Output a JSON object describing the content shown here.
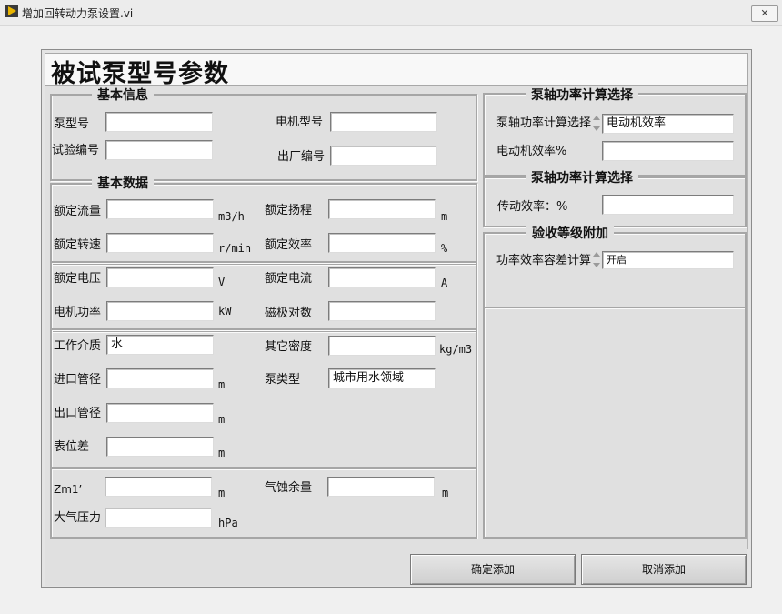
{
  "window": {
    "title": "增加回转动力泵设置.vi"
  },
  "header": {
    "title": "被试泵型号参数"
  },
  "basic_info": {
    "legend": "基本信息",
    "pump_model": {
      "label": "泵型号",
      "value": ""
    },
    "motor_model": {
      "label": "电机型号",
      "value": ""
    },
    "test_number": {
      "label": "试验编号",
      "value": ""
    },
    "factory_number": {
      "label": "出厂编号",
      "value": ""
    }
  },
  "basic_data": {
    "legend": "基本数据",
    "rated_flow": {
      "label": "额定流量",
      "unit": "m3/h",
      "value": ""
    },
    "rated_head": {
      "label": "额定扬程",
      "unit": "m",
      "value": ""
    },
    "rated_speed": {
      "label": "额定转速",
      "unit": "r/min",
      "value": ""
    },
    "rated_efficiency": {
      "label": "额定效率",
      "unit": "%",
      "value": ""
    },
    "rated_voltage": {
      "label": "额定电压",
      "unit": "V",
      "value": ""
    },
    "rated_current": {
      "label": "额定电流",
      "unit": "A",
      "value": ""
    },
    "motor_power": {
      "label": "电机功率",
      "unit": "kW",
      "value": ""
    },
    "pole_pairs": {
      "label": "磁极对数",
      "value": ""
    },
    "medium": {
      "label": "工作介质",
      "value": "水"
    },
    "other_density": {
      "label": "其它密度",
      "unit": "kg/m3",
      "value": ""
    },
    "inlet_pipe": {
      "label": "进口管径",
      "unit": "m",
      "value": ""
    },
    "pump_type": {
      "label": "泵类型",
      "value": "城市用水领域"
    },
    "outlet_pipe": {
      "label": "出口管径",
      "unit": "m",
      "value": ""
    },
    "gauge_diff": {
      "label": "表位差",
      "unit": "m",
      "value": ""
    },
    "zm1": {
      "label": "Zm1’",
      "unit": "m",
      "value": ""
    },
    "npsh": {
      "label": "气蚀余量",
      "unit": "m",
      "value": ""
    },
    "atm_pressure": {
      "label": "大气压力",
      "unit": "hPa",
      "value": ""
    }
  },
  "shaft_power": {
    "legend": "泵轴功率计算选择",
    "method": {
      "label": "泵轴功率计算选择",
      "value": "电动机效率"
    },
    "motor_eff": {
      "label": "电动机效率%",
      "value": ""
    }
  },
  "transmission": {
    "legend": "泵轴功率计算选择",
    "eff": {
      "label": "传动效率：%",
      "value": ""
    }
  },
  "acceptance": {
    "legend": "验收等级附加",
    "tolerance": {
      "label": "功率效率容差计算",
      "value": "开启"
    }
  },
  "buttons": {
    "confirm": "确定添加",
    "cancel": "取消添加"
  },
  "colors": {
    "frame_bg": "#e4e4e4",
    "field_bg": "#ffffff",
    "title_icon": "#e8b400"
  },
  "icons": {
    "window": "labview-vi-icon",
    "close": "close-icon"
  }
}
